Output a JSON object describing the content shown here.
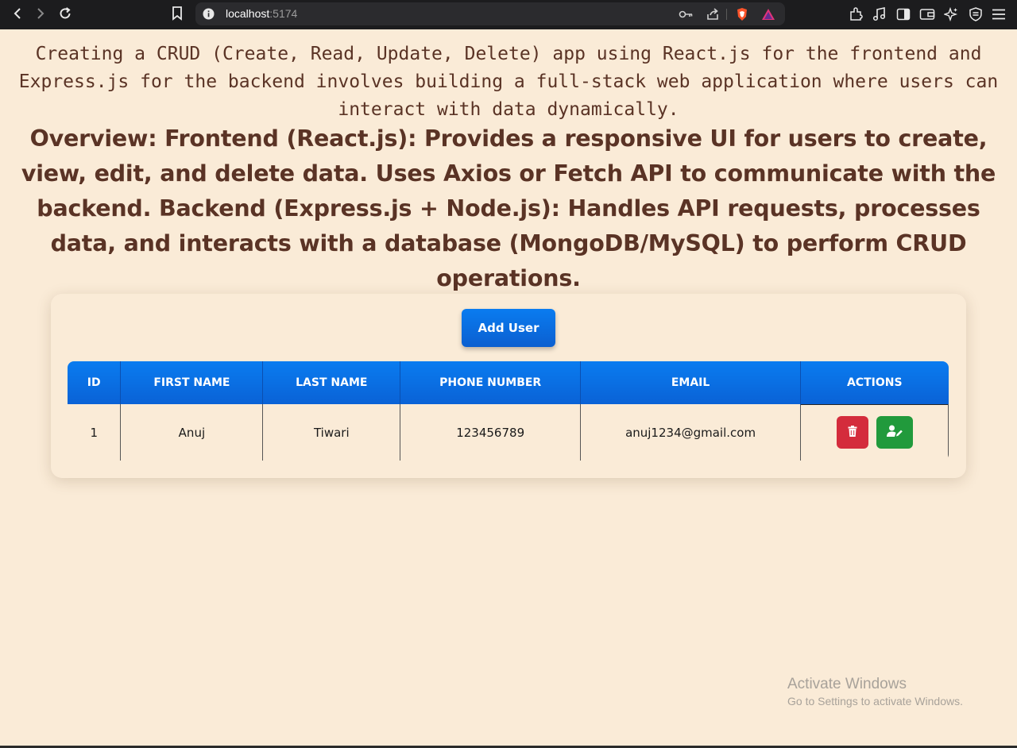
{
  "browser": {
    "url_host": "localhost",
    "url_port": ":5174"
  },
  "intro_text": "Creating a CRUD (Create, Read, Update, Delete) app using React.js for the frontend and Express.js for the backend involves building a full-stack web application where users can interact with data dynamically.",
  "overview_text": "Overview: Frontend (React.js): Provides a responsive UI for users to create, view, edit, and delete data. Uses Axios or Fetch API to communicate with the backend. Backend (Express.js + Node.js): Handles API requests, processes data, and interacts with a database (MongoDB/MySQL) to perform CRUD operations.",
  "add_user_label": "Add User",
  "table": {
    "headers": [
      "ID",
      "FIRST NAME",
      "LAST NAME",
      "PHONE NUMBER",
      "EMAIL",
      "ACTIONS"
    ],
    "rows": [
      {
        "id": "1",
        "first_name": "Anuj",
        "last_name": "Tiwari",
        "phone": "123456789",
        "email": "anuj1234@gmail.com"
      }
    ]
  },
  "icons": {
    "delete": "trash-icon",
    "edit": "user-edit-icon"
  },
  "colors": {
    "background": "#faebd7",
    "text": "#5a3325",
    "primary": "#0a6fe6",
    "danger": "#d42c3c",
    "success": "#219a3c"
  },
  "watermark": {
    "title": "Activate Windows",
    "subtitle": "Go to Settings to activate Windows."
  }
}
